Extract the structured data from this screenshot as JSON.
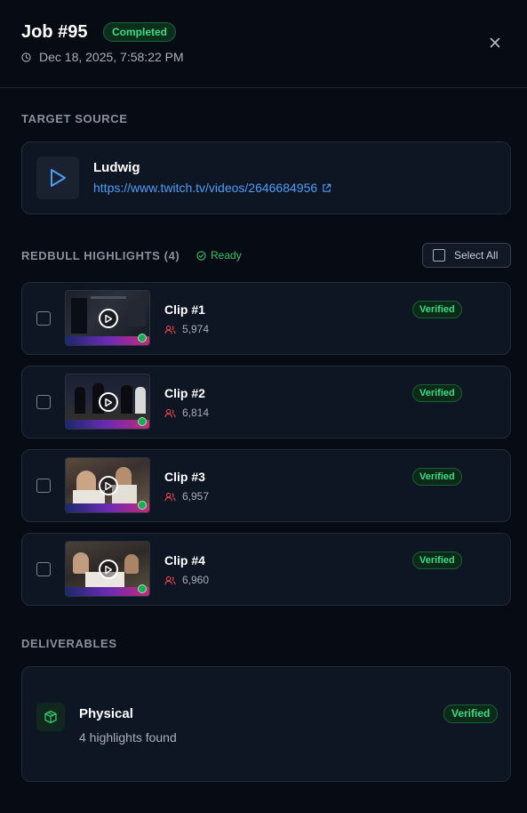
{
  "header": {
    "title": "Job #95",
    "status": "Completed",
    "timestamp": "Dec 18, 2025, 7:58:22 PM"
  },
  "target_source": {
    "section_label": "TARGET SOURCE",
    "name": "Ludwig",
    "url": "https://www.twitch.tv/videos/2646684956"
  },
  "highlights": {
    "section_label": "REDBULL HIGHLIGHTS (4)",
    "status": "Ready",
    "select_all_label": "Select All",
    "clips": [
      {
        "title": "Clip #1",
        "views": "5,974",
        "badge": "Verified"
      },
      {
        "title": "Clip #2",
        "views": "6,814",
        "badge": "Verified"
      },
      {
        "title": "Clip #3",
        "views": "6,957",
        "badge": "Verified"
      },
      {
        "title": "Clip #4",
        "views": "6,960",
        "badge": "Verified"
      }
    ]
  },
  "deliverables": {
    "section_label": "DELIVERABLES",
    "title": "Physical",
    "subtitle": "4 highlights found",
    "badge": "Verified"
  },
  "colors": {
    "background": "#070b14",
    "card": "#0f1623",
    "accent_green": "#3ddc84",
    "link_blue": "#4f9cf6",
    "viewer_red": "#e5484d"
  },
  "icons": {
    "timestamp": "clock-icon",
    "close": "close-icon",
    "source": "play-icon",
    "external": "external-link-icon",
    "ready": "check-circle-icon",
    "views": "users-icon",
    "deliverable": "box-icon"
  }
}
